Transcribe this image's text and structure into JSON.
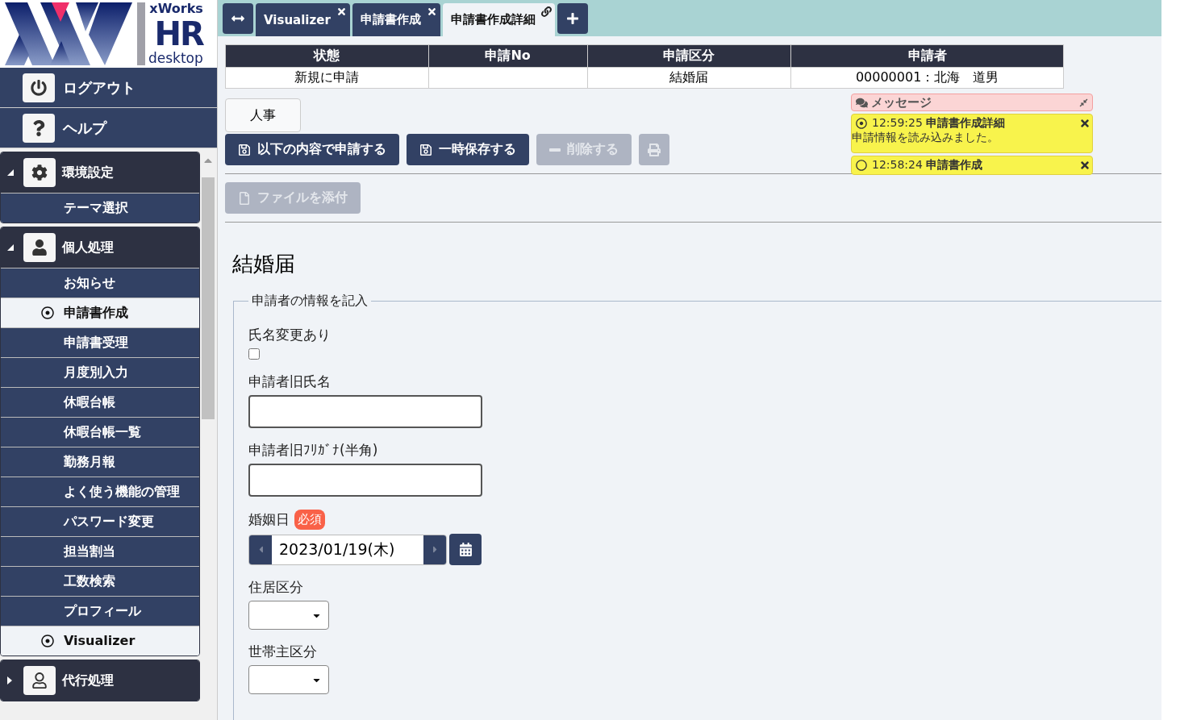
{
  "logo": {
    "brand": "xWorks",
    "product": "HR",
    "sub": "desktop"
  },
  "sidebar": {
    "top_items": [
      {
        "label": "ログアウト"
      },
      {
        "label": "ヘルプ"
      }
    ],
    "groups": [
      {
        "label": "環境設定",
        "expanded": true,
        "children": [
          {
            "label": "テーマ選択",
            "selected": false
          }
        ]
      },
      {
        "label": "個人処理",
        "expanded": true,
        "children": [
          {
            "label": "お知らせ",
            "selected": false
          },
          {
            "label": "申請書作成",
            "selected": true
          },
          {
            "label": "申請書受理",
            "selected": false
          },
          {
            "label": "月度別入力",
            "selected": false
          },
          {
            "label": "休暇台帳",
            "selected": false
          },
          {
            "label": "休暇台帳一覧",
            "selected": false
          },
          {
            "label": "勤務月報",
            "selected": false
          },
          {
            "label": "よく使う機能の管理",
            "selected": false
          },
          {
            "label": "パスワード変更",
            "selected": false
          },
          {
            "label": "担当割当",
            "selected": false
          },
          {
            "label": "工数検索",
            "selected": false
          },
          {
            "label": "プロフィール",
            "selected": false
          },
          {
            "label": "Visualizer",
            "selected": true
          }
        ]
      },
      {
        "label": "代行処理",
        "expanded": false
      }
    ]
  },
  "tabs": [
    {
      "label": "Visualizer",
      "selected": false
    },
    {
      "label": "申請書作成",
      "selected": false
    },
    {
      "label": "申請書作成詳細",
      "selected": true
    }
  ],
  "summary": {
    "columns": [
      "状態",
      "申請No",
      "申請区分",
      "申請者"
    ],
    "rows": [
      [
        "新規に申請",
        null,
        "結婚届",
        "00000001：北海　道男"
      ]
    ]
  },
  "category_button": "人事",
  "actions": [
    {
      "kind": "save",
      "label": "以下の内容で申請する",
      "disabled": false
    },
    {
      "kind": "save",
      "label": "一時保存する",
      "disabled": false
    },
    {
      "kind": "delete",
      "label": "削除する",
      "disabled": true
    },
    {
      "kind": "print",
      "disabled": true
    }
  ],
  "attach": {
    "label": "ファイルを添付",
    "disabled": true
  },
  "messages": {
    "title": "メッセージ",
    "items": [
      {
        "time": "12:59:25",
        "source": "申請書作成詳細",
        "text": "申請情報を読み込みました。",
        "selected": true
      },
      {
        "time": "12:58:24",
        "source": "申請書作成",
        "selected": false
      }
    ]
  },
  "form": {
    "title": "結婚届",
    "section": "申請者の情報を記入",
    "fields": [
      {
        "kind": "checkbox",
        "label": "氏名変更あり",
        "checked": false
      },
      {
        "kind": "text",
        "label": "申請者旧氏名"
      },
      {
        "kind": "text",
        "label": "申請者旧ﾌﾘｶﾞﾅ(半角)"
      },
      {
        "kind": "date",
        "label": "婚姻日",
        "badge": "必須",
        "value": "2023/01/19(木)"
      },
      {
        "kind": "select",
        "label": "住居区分"
      },
      {
        "kind": "select",
        "label": "世帯主区分"
      }
    ]
  }
}
